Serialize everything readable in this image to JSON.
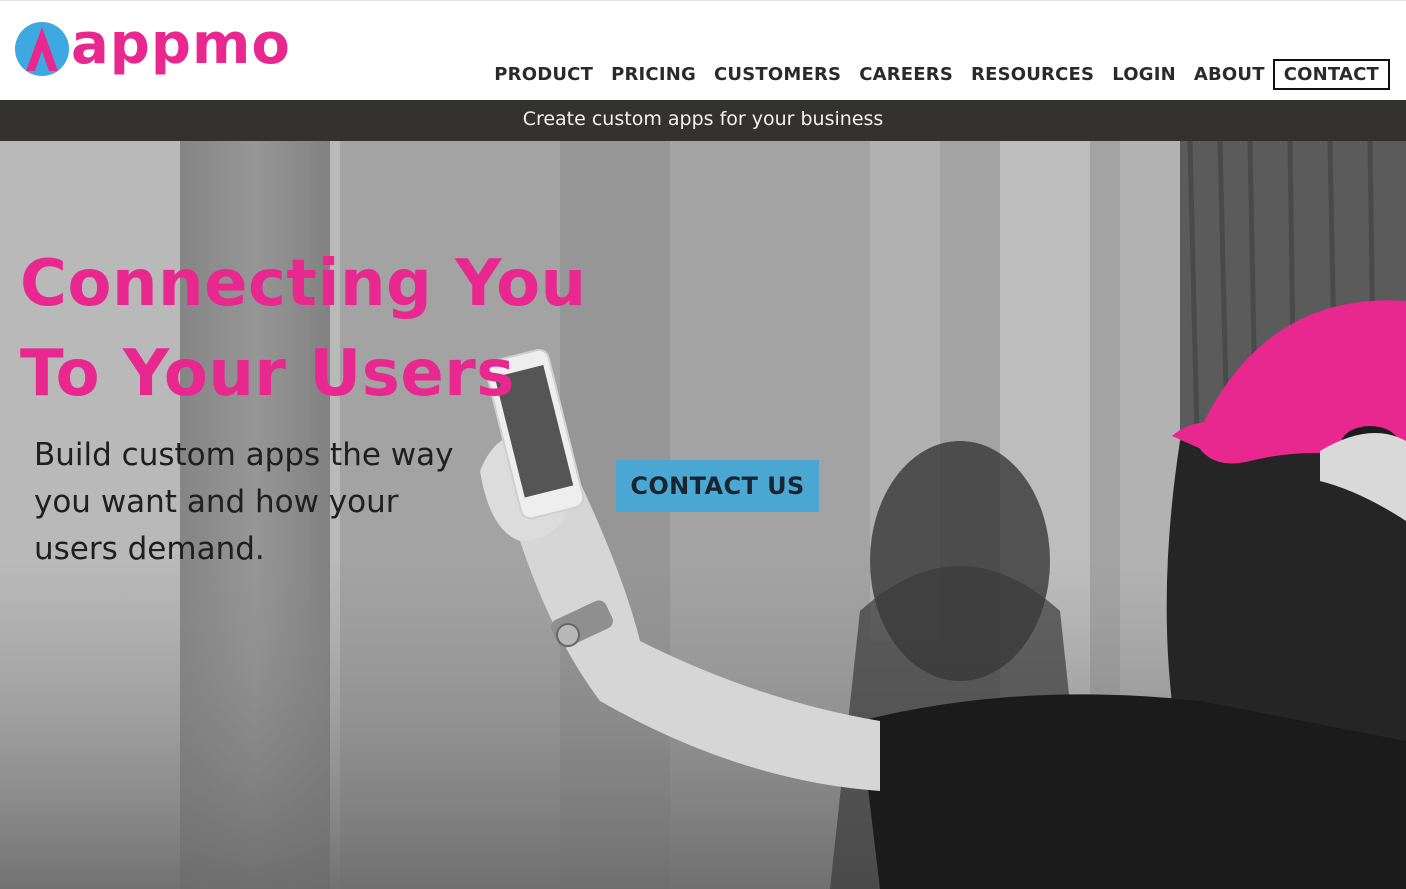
{
  "brand": {
    "name": "appmo",
    "logo_icon": "appmo-a-icon",
    "colors": {
      "pink": "#e8288f",
      "blue": "#3da9e0",
      "cta_blue": "#4aa8d2",
      "bar_dark": "#333230"
    }
  },
  "nav": {
    "items": [
      {
        "label": "PRODUCT"
      },
      {
        "label": "PRICING"
      },
      {
        "label": "CUSTOMERS"
      },
      {
        "label": "CAREERS"
      },
      {
        "label": "RESOURCES"
      },
      {
        "label": "LOGIN"
      },
      {
        "label": "ABOUT"
      }
    ],
    "contact_label": "CONTACT"
  },
  "tagline": "Create custom apps for your business",
  "hero": {
    "headline_line1": "Connecting You",
    "headline_line2": "To Your Users",
    "subtext": "Build custom apps the way you want and how your users demand.",
    "cta_label": "CONTACT US"
  }
}
